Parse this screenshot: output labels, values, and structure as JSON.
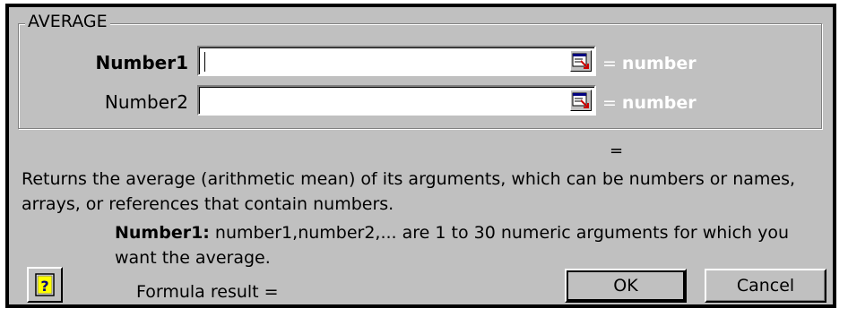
{
  "dialog": {
    "function_name": "AVERAGE",
    "arguments": [
      {
        "label": "Number1",
        "value": "",
        "eq_sign": "=",
        "eq_value": "number"
      },
      {
        "label": "Number2",
        "value": "",
        "eq_sign": "=",
        "eq_value": "number"
      }
    ],
    "result_equals": "=",
    "description": "Returns the average (arithmetic mean) of its arguments, which can be numbers or names, arrays, or references that contain numbers.",
    "arg_help_name": "Number1:",
    "arg_help_text": "number1,number2,... are 1 to 30 numeric arguments for which you want the average.",
    "formula_result_label": "Formula result =",
    "ok_label": "OK",
    "cancel_label": "Cancel"
  },
  "icons": {
    "collapse": "collapse-dialog-icon",
    "help": "help-icon"
  },
  "colors": {
    "dialog_bg": "#c0c0c0",
    "eq_value_text": "#ffffff"
  }
}
